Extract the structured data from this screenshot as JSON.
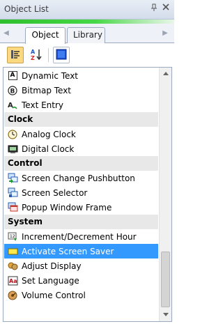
{
  "window": {
    "title": "Object List",
    "pin_icon": "pin-icon",
    "close_icon": "close-icon"
  },
  "tabs": {
    "left_arrow": "◀",
    "right_arrow": "▶",
    "items": [
      {
        "label": "Object",
        "active": true
      },
      {
        "label": "Library",
        "active": false
      }
    ]
  },
  "toolbar": {
    "buttons": [
      {
        "name": "categorized-view-button",
        "icon": "categorized-icon",
        "pressed": true
      },
      {
        "name": "sort-az-button",
        "icon": "sort-az-icon",
        "pressed": false
      },
      {
        "name": "property-pages-button",
        "icon": "property-pages-icon",
        "pressed": false
      }
    ]
  },
  "list": {
    "rows": [
      {
        "kind": "item",
        "label": "Dynamic Text",
        "icon": "dynamic-text-icon"
      },
      {
        "kind": "item",
        "label": "Bitmap Text",
        "icon": "bitmap-text-icon"
      },
      {
        "kind": "item",
        "label": "Text Entry",
        "icon": "text-entry-icon"
      },
      {
        "kind": "category",
        "label": "Clock"
      },
      {
        "kind": "item",
        "label": "Analog Clock",
        "icon": "analog-clock-icon"
      },
      {
        "kind": "item",
        "label": "Digital Clock",
        "icon": "digital-clock-icon"
      },
      {
        "kind": "category",
        "label": "Control"
      },
      {
        "kind": "item",
        "label": "Screen Change Pushbutton",
        "icon": "screen-change-icon"
      },
      {
        "kind": "item",
        "label": "Screen Selector",
        "icon": "screen-selector-icon"
      },
      {
        "kind": "item",
        "label": "Popup Window Frame",
        "icon": "popup-window-icon"
      },
      {
        "kind": "category",
        "label": "System"
      },
      {
        "kind": "item",
        "label": "Increment/Decrement Hour",
        "icon": "increment-hour-icon"
      },
      {
        "kind": "item",
        "label": "Activate Screen Saver",
        "icon": "screen-saver-icon",
        "selected": true
      },
      {
        "kind": "item",
        "label": "Adjust Display",
        "icon": "adjust-display-icon"
      },
      {
        "kind": "item",
        "label": "Set Language",
        "icon": "set-language-icon"
      },
      {
        "kind": "item",
        "label": "Volume Control",
        "icon": "volume-control-icon"
      }
    ]
  },
  "colors": {
    "selection": "#3399ff",
    "category_bg": "#e8e8e8",
    "accent_green": "#2fbf2f"
  }
}
